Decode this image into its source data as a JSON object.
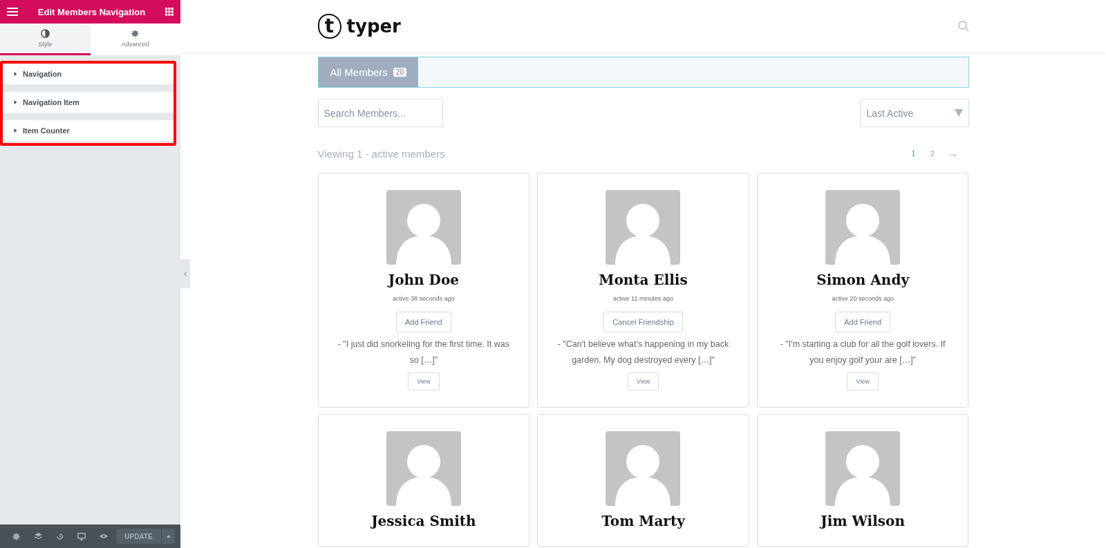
{
  "editor": {
    "title": "Edit Members Navigation",
    "tabs": [
      {
        "label": "Style",
        "selected": true
      },
      {
        "label": "Advanced",
        "selected": false
      }
    ],
    "sections": [
      {
        "label": "Navigation",
        "expanded": false
      },
      {
        "label": "Navigation Item",
        "expanded": false
      },
      {
        "label": "Item Counter",
        "expanded": false
      }
    ],
    "update_button": "UPDATE"
  },
  "site": {
    "logo_mark": "t",
    "logo_text": "typer"
  },
  "members": {
    "nav": [
      {
        "label": "All Members",
        "count": "20",
        "selected": true
      }
    ],
    "search": {
      "placeholder": "Search Members..."
    },
    "sort": {
      "value": "Last Active"
    },
    "viewing": "Viewing 1 - active members",
    "pages": [
      {
        "label": "1",
        "selected": true
      },
      {
        "label": "2",
        "selected": false
      }
    ],
    "next": "→",
    "cards": [
      {
        "name": "John Doe",
        "activity": "active 38 seconds ago",
        "action": "Add Friend",
        "quote": "- \"I just did snorkeling for the first time. It was so […]\"",
        "view": "View"
      },
      {
        "name": "Monta Ellis",
        "activity": "active 11 minutes ago",
        "action": "Cancel Friendship",
        "quote": "- \"Can't believe what's happening in my back garden. My dog destroyed every […]\"",
        "view": "View"
      },
      {
        "name": "Simon Andy",
        "activity": "active 20 seconds ago",
        "action": "Add Friend",
        "quote": "- \"I'm starting a club for all the golf lovers. If you enjoy golf your are […]\"",
        "view": "View"
      },
      {
        "name": "Jessica Smith"
      },
      {
        "name": "Tom Marty"
      },
      {
        "name": "Jim Wilson"
      }
    ]
  }
}
